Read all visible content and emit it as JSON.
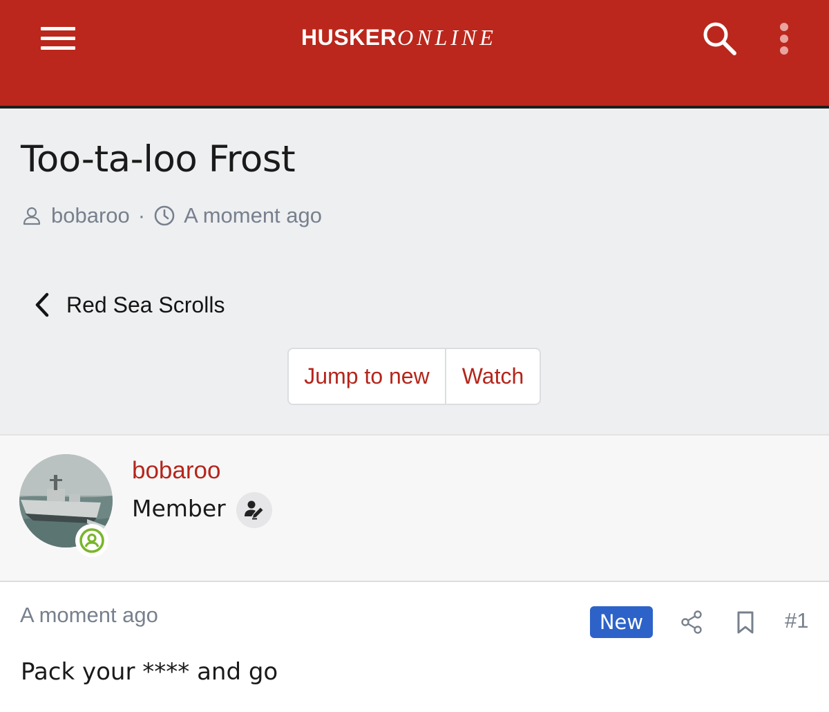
{
  "header": {
    "logo_bold": "HUSKER",
    "logo_italic": "ONLINE",
    "menu_icon": "hamburger-menu-icon",
    "search_icon": "search-icon",
    "more_icon": "more-vertical-icon",
    "bar_color": "#bb271c"
  },
  "thread": {
    "title": "Too-ta-loo Frost",
    "author": "bobaroo",
    "separator": "·",
    "time": "A moment ago"
  },
  "navigation": {
    "back_label": "Red Sea Scrolls",
    "back_icon": "chevron-left-icon"
  },
  "actions": {
    "jump_label": "Jump to new",
    "watch_label": "Watch",
    "accent_color": "#b5251b"
  },
  "post": {
    "username": "bobaroo",
    "role": "Member",
    "online_icon": "online-status-icon",
    "role_icon": "user-edit-icon",
    "time": "A moment ago",
    "badge": "New",
    "badge_color": "#2d63c8",
    "number": "#1",
    "body": "Pack your **** and go"
  }
}
